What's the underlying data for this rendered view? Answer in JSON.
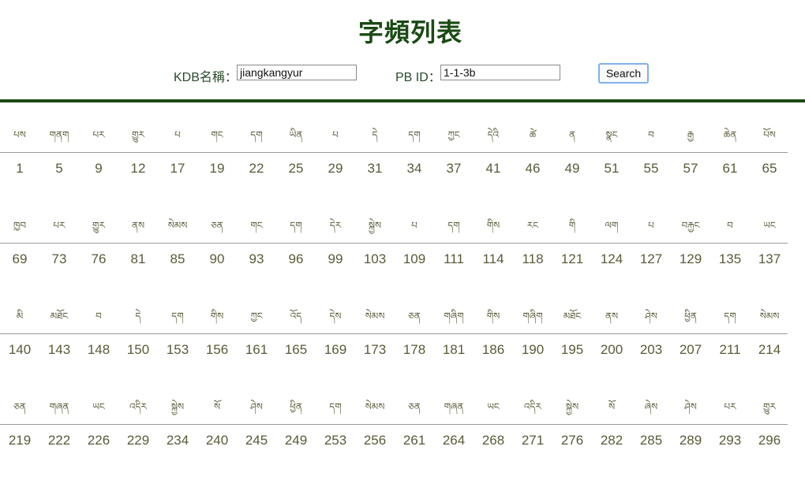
{
  "page": {
    "title": "字頻列表"
  },
  "form": {
    "kdb_label": "KDB名稱：",
    "kdb_value": "jiangkangyur",
    "pb_label": "PB ID：",
    "pb_value": "1-1-3b",
    "search_label": "Search"
  },
  "rows": [
    {
      "words": [
        "པས",
        "གནག",
        "པར",
        "གྱུར",
        "པ",
        "གང",
        "དག",
        "ཡིན",
        "པ",
        "དེ",
        "དག",
        "ཀྱང",
        "དེའི",
        "ཚེ",
        "ན",
        "སྣང",
        "བ",
        "རྒྱ",
        "ཆེན",
        "པོས"
      ],
      "counts": [
        "1",
        "5",
        "9",
        "12",
        "17",
        "19",
        "22",
        "25",
        "29",
        "31",
        "34",
        "37",
        "41",
        "46",
        "49",
        "51",
        "55",
        "57",
        "61",
        "65"
      ]
    },
    {
      "words": [
        "ཁྱབ",
        "པར",
        "གྱུར",
        "ནས",
        "སེམས",
        "ཅན",
        "གང",
        "དག",
        "དེར",
        "སྐྱེས",
        "པ",
        "དག",
        "གིས",
        "རང",
        "གི",
        "ལག",
        "པ",
        "བརྐྱང",
        "བ",
        "ཡང"
      ],
      "counts": [
        "69",
        "73",
        "76",
        "81",
        "85",
        "90",
        "93",
        "96",
        "99",
        "103",
        "109",
        "111",
        "114",
        "118",
        "121",
        "124",
        "127",
        "129",
        "135",
        "137"
      ]
    },
    {
      "words": [
        "མི",
        "མཐོང",
        "བ",
        "དེ",
        "དག",
        "གིས",
        "ཀྱང",
        "འོད",
        "དེས",
        "སེམས",
        "ཅན",
        "གཞིག",
        "གིས",
        "གཞིག",
        "མཐོང",
        "ནས",
        "ཤེས",
        "ཕྱིན",
        "དག",
        "སེམས"
      ],
      "counts": [
        "140",
        "143",
        "148",
        "150",
        "153",
        "156",
        "161",
        "165",
        "169",
        "173",
        "178",
        "181",
        "186",
        "190",
        "195",
        "200",
        "203",
        "207",
        "211",
        "214"
      ]
    },
    {
      "words": [
        "ཅན",
        "གཞན",
        "ཡང",
        "འདིར",
        "སྐྱེས",
        "སོ",
        "ཤེས",
        "ཕྱིན",
        "དག",
        "སེམས",
        "ཅན",
        "གཞན",
        "ཡང",
        "འདིར",
        "སྐྱེས",
        "སོ",
        "ཞེས",
        "ཤེས",
        "པར",
        "གྱུར"
      ],
      "counts": [
        "219",
        "222",
        "226",
        "229",
        "234",
        "240",
        "245",
        "249",
        "253",
        "256",
        "261",
        "264",
        "268",
        "271",
        "276",
        "282",
        "285",
        "289",
        "293",
        "296"
      ]
    }
  ]
}
